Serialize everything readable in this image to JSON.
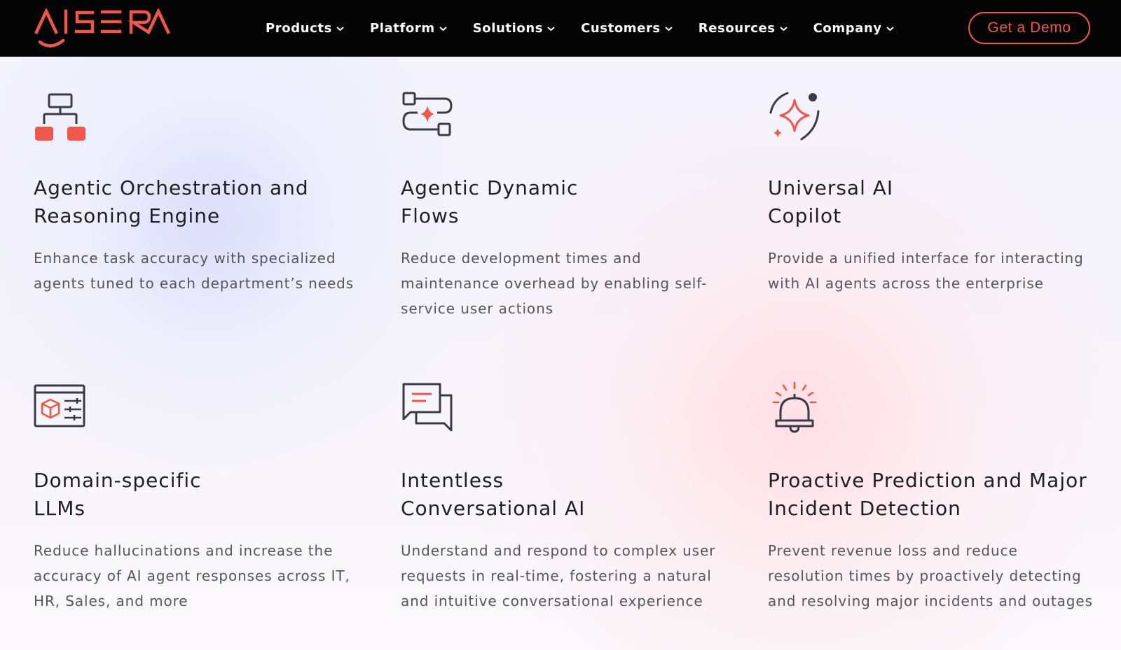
{
  "brand": {
    "name": "AISERA",
    "accent": "#f0574c",
    "nav_bg": "#050505"
  },
  "nav": {
    "items": [
      {
        "label": "Products"
      },
      {
        "label": "Platform"
      },
      {
        "label": "Solutions"
      },
      {
        "label": "Customers"
      },
      {
        "label": "Resources"
      },
      {
        "label": "Company"
      }
    ],
    "demo_label": "Get a Demo"
  },
  "features": [
    {
      "icon": "hierarchy-icon",
      "title_1": "Agentic Orchestration and",
      "title_2": "Reasoning Engine",
      "desc": "Enhance task accuracy with specialized agents tuned to each department’s needs"
    },
    {
      "icon": "flow-icon",
      "title_1": "Agentic Dynamic",
      "title_2": "Flows",
      "desc": "Reduce development times and maintenance overhead by enabling self-service user actions"
    },
    {
      "icon": "sparkle-icon",
      "title_1": "Universal AI",
      "title_2": "Copilot",
      "desc": "Provide a unified interface for interacting with AI agents across the enterprise"
    },
    {
      "icon": "browser-cube-icon",
      "title_1": "Domain-specific",
      "title_2": "LLMs",
      "desc": "Reduce hallucinations and increase the accuracy of AI agent responses across IT, HR, Sales, and more"
    },
    {
      "icon": "chat-bubbles-icon",
      "title_1": "Intentless",
      "title_2": "Conversational AI",
      "desc": "Understand and respond to complex user requests in real-time, fostering a natural and intuitive conversational experience"
    },
    {
      "icon": "bell-alert-icon",
      "title_1": "Proactive Prediction and Major",
      "title_2": "Incident Detection",
      "desc": "Prevent revenue loss and reduce resolution times by proactively detecting and resolving major incidents and outages"
    }
  ]
}
